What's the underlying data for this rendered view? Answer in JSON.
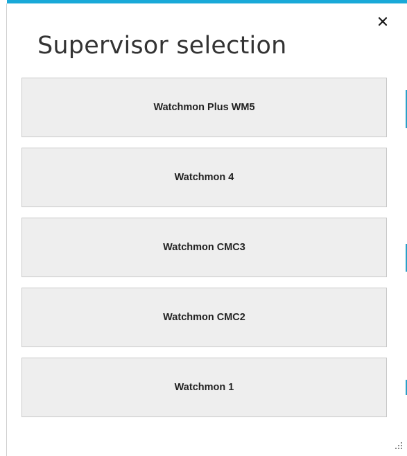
{
  "dialog": {
    "title": "Supervisor selection",
    "close_glyph": "✕",
    "accent_color": "#19a9d8"
  },
  "options": [
    {
      "label": "Watchmon Plus WM5"
    },
    {
      "label": "Watchmon 4"
    },
    {
      "label": "Watchmon CMC3"
    },
    {
      "label": "Watchmon CMC2"
    },
    {
      "label": "Watchmon 1"
    }
  ],
  "icons": {
    "close": "close-icon",
    "resize_grip": "resize-grip-icon"
  }
}
